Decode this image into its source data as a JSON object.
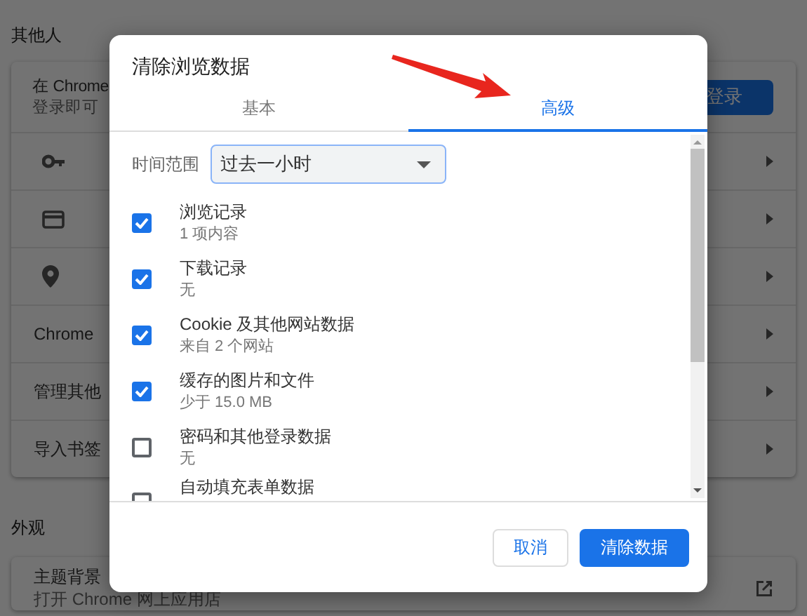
{
  "page": {
    "sections": [
      {
        "heading": "其他人",
        "rows": [
          {
            "kind": "signin",
            "title": "在 Chrome",
            "subtitle": "登录即可",
            "button": "登录"
          },
          {
            "kind": "icon"
          },
          {
            "kind": "icon"
          },
          {
            "kind": "icon"
          },
          {
            "kind": "link",
            "title": "Chrome"
          },
          {
            "kind": "link",
            "title": "管理其他"
          },
          {
            "kind": "link",
            "title": "导入书签"
          }
        ]
      },
      {
        "heading": "外观",
        "rows": [
          {
            "kind": "external",
            "title": "主题背景",
            "subtitle": "打开 Chrome 网上应用店"
          }
        ]
      }
    ]
  },
  "dialog": {
    "title": "清除浏览数据",
    "tabs": [
      {
        "label": "基本",
        "selected": false
      },
      {
        "label": "高级",
        "selected": true
      }
    ],
    "time_range": {
      "label": "时间范围",
      "value": "过去一小时"
    },
    "items": [
      {
        "label": "浏览记录",
        "detail": "1 项内容",
        "checked": true
      },
      {
        "label": "下载记录",
        "detail": "无",
        "checked": true
      },
      {
        "label": "Cookie 及其他网站数据",
        "detail": "来自 2 个网站",
        "checked": true
      },
      {
        "label": "缓存的图片和文件",
        "detail": "少于 15.0 MB",
        "checked": true
      },
      {
        "label": "密码和其他登录数据",
        "detail": "无",
        "checked": false
      },
      {
        "label": "自动填充表单数据",
        "checked": false
      }
    ],
    "buttons": [
      {
        "label": "取消",
        "kind": "secondary"
      },
      {
        "label": "清除数据",
        "kind": "primary"
      }
    ]
  }
}
